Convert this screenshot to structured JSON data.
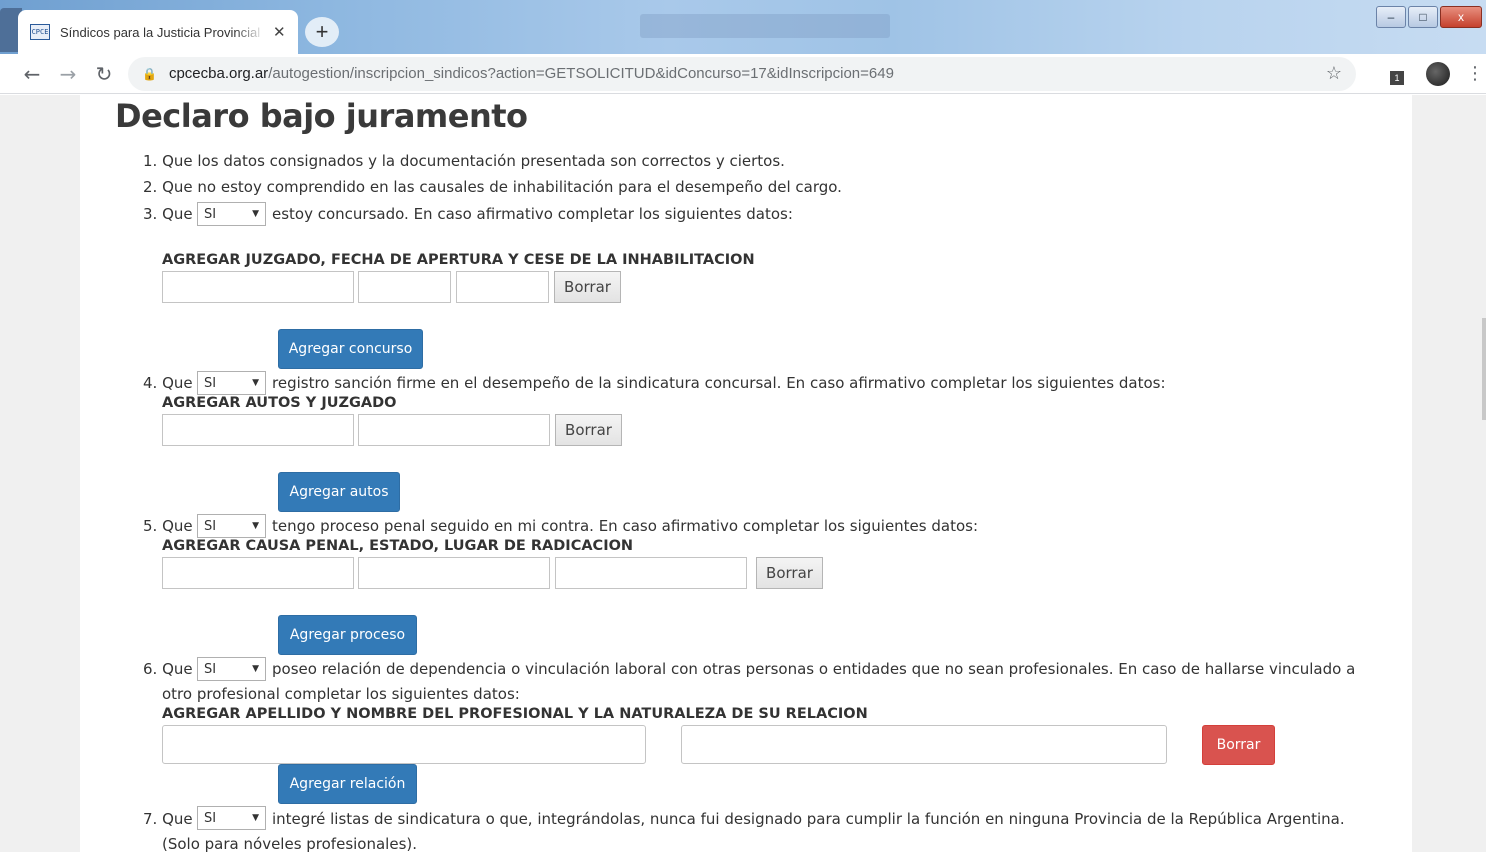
{
  "browser": {
    "tab_title": "Síndicos para la Justicia Provincial",
    "tab_close": "✕",
    "new_tab": "+",
    "favicon_text": "CPCE",
    "url_host": "cpcecba.org.ar",
    "url_path": "/autogestion/inscripcion_sindicos?action=GETSOLICITUD&idConcurso=17&idInscripcion=649",
    "ext_badge": "1",
    "window_buttons": {
      "minimize": "‒",
      "maximize": "□",
      "close": "x"
    }
  },
  "page": {
    "title": "Declaro bajo juramento",
    "item1": "1. Que los datos consignados y la documentación presentada son correctos y ciertos.",
    "item2": "2. Que no estoy comprendido en las causales de inhabilitación para el desempeño del cargo.",
    "item3": {
      "prefix": "3. Que",
      "select": "SI",
      "text": "estoy concursado. En caso afirmativo completar los siguientes datos:"
    },
    "section3_label": "AGREGAR JUZGADO, FECHA DE APERTURA Y CESE DE LA INHABILITACION",
    "item4": {
      "prefix": "4. Que",
      "select": "SI",
      "text": "registro sanción firme en el desempeño de la sindicatura concursal. En caso afirmativo completar los siguientes datos:"
    },
    "section4_label": "AGREGAR AUTOS Y JUZGADO",
    "item5": {
      "prefix": "5. Que",
      "select": "SI",
      "text": "tengo proceso penal seguido en mi contra. En caso afirmativo completar los siguientes datos:"
    },
    "section5_label": "AGREGAR CAUSA PENAL, ESTADO, LUGAR DE RADICACION",
    "item6": {
      "prefix": "6. Que",
      "select": "SI",
      "text": "poseo relación de dependencia o vinculación laboral con otras personas o entidades que no sean profesionales. En caso de hallarse vinculado a",
      "text2": "otro profesional completar los siguientes datos:"
    },
    "section6_label": "AGREGAR APELLIDO Y NOMBRE DEL PROFESIONAL Y LA NATURALEZA DE SU RELACION",
    "item7": {
      "prefix": "7. Que",
      "select": "SI",
      "text": "integré listas de sindicatura o que, integrándolas, nunca fui designado para cumplir la función en ninguna Provincia de la República Argentina.",
      "text2": "(Solo para nóveles profesionales)."
    },
    "buttons": {
      "borrar": "Borrar",
      "agregar_concurso": "Agregar concurso",
      "agregar_autos": "Agregar autos",
      "agregar_proceso": "Agregar proceso",
      "agregar_relacion": "Agregar relación"
    },
    "colors": {
      "primary": "#337ab7",
      "danger": "#d9534f"
    }
  }
}
